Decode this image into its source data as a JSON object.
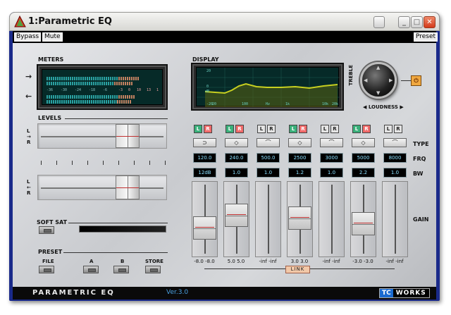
{
  "window": {
    "title": "1:Parametric EQ"
  },
  "toolbar": {
    "bypass": "Bypass",
    "mute": "Mute",
    "preset": "Preset"
  },
  "sections": {
    "meters": "METERS",
    "levels": "LEVELS",
    "display": "DISPLAY",
    "soft_sat": "SOFT SAT",
    "preset": "PRESET",
    "loudness": "LOUDNESS",
    "treble": "TREBLE"
  },
  "meter_ticks": [
    "-36",
    "-30",
    "-24",
    "-18",
    "-6",
    "-3",
    "0",
    "10",
    "13",
    "1"
  ],
  "display_labels": {
    "db_top": "20",
    "db_mid": "0",
    "db_unit": "dB",
    "db_bot": "-20",
    "freqs": [
      "20",
      "100",
      "Hz",
      "1k",
      "10k",
      "20k"
    ]
  },
  "row_labels": {
    "type": "TYPE",
    "frq": "FRQ",
    "bw": "BW",
    "gain": "GAIN"
  },
  "bands": [
    {
      "L": true,
      "R": true,
      "type_glyph": "⊃",
      "frq": "120.0",
      "bw": "12dB",
      "gain": "-8.0 -8.0",
      "gain_level": 0.35
    },
    {
      "L": true,
      "R": true,
      "type_glyph": "◇",
      "frq": "240.0",
      "bw": "1.0",
      "gain": "5.0 5.0",
      "gain_level": 0.6
    },
    {
      "L": false,
      "R": false,
      "type_glyph": "⌒",
      "frq": "500.0",
      "bw": "1.0",
      "gain": "-inf -inf",
      "gain_level": null
    },
    {
      "L": true,
      "R": true,
      "type_glyph": "◇",
      "frq": "2500",
      "bw": "1.2",
      "gain": "3.0 3.0",
      "gain_level": 0.55
    },
    {
      "L": false,
      "R": false,
      "type_glyph": "⌒",
      "frq": "3000",
      "bw": "1.0",
      "gain": "-inf -inf",
      "gain_level": null
    },
    {
      "L": true,
      "R": true,
      "type_glyph": "◇",
      "frq": "5000",
      "bw": "2.2",
      "gain": "-3.0 -3.0",
      "gain_level": 0.43
    },
    {
      "L": false,
      "R": false,
      "type_glyph": "⌒",
      "frq": "8000",
      "bw": "1.0",
      "gain": "-inf -inf",
      "gain_level": null
    }
  ],
  "link_label": "LINK",
  "preset_buttons": [
    "FILE",
    "A",
    "B",
    "STORE"
  ],
  "footer": {
    "title": "PARAMETRIC EQ",
    "version": "Ver.3.0",
    "logo_a": "TC",
    "logo_b": "WORKS"
  },
  "colors": {
    "title_bar": "#e8e8e6",
    "footer": "#0a0a0a",
    "lcd_bg": "#062a28",
    "lcd_text": "#8ae0ff",
    "curve": "#b8c020"
  }
}
